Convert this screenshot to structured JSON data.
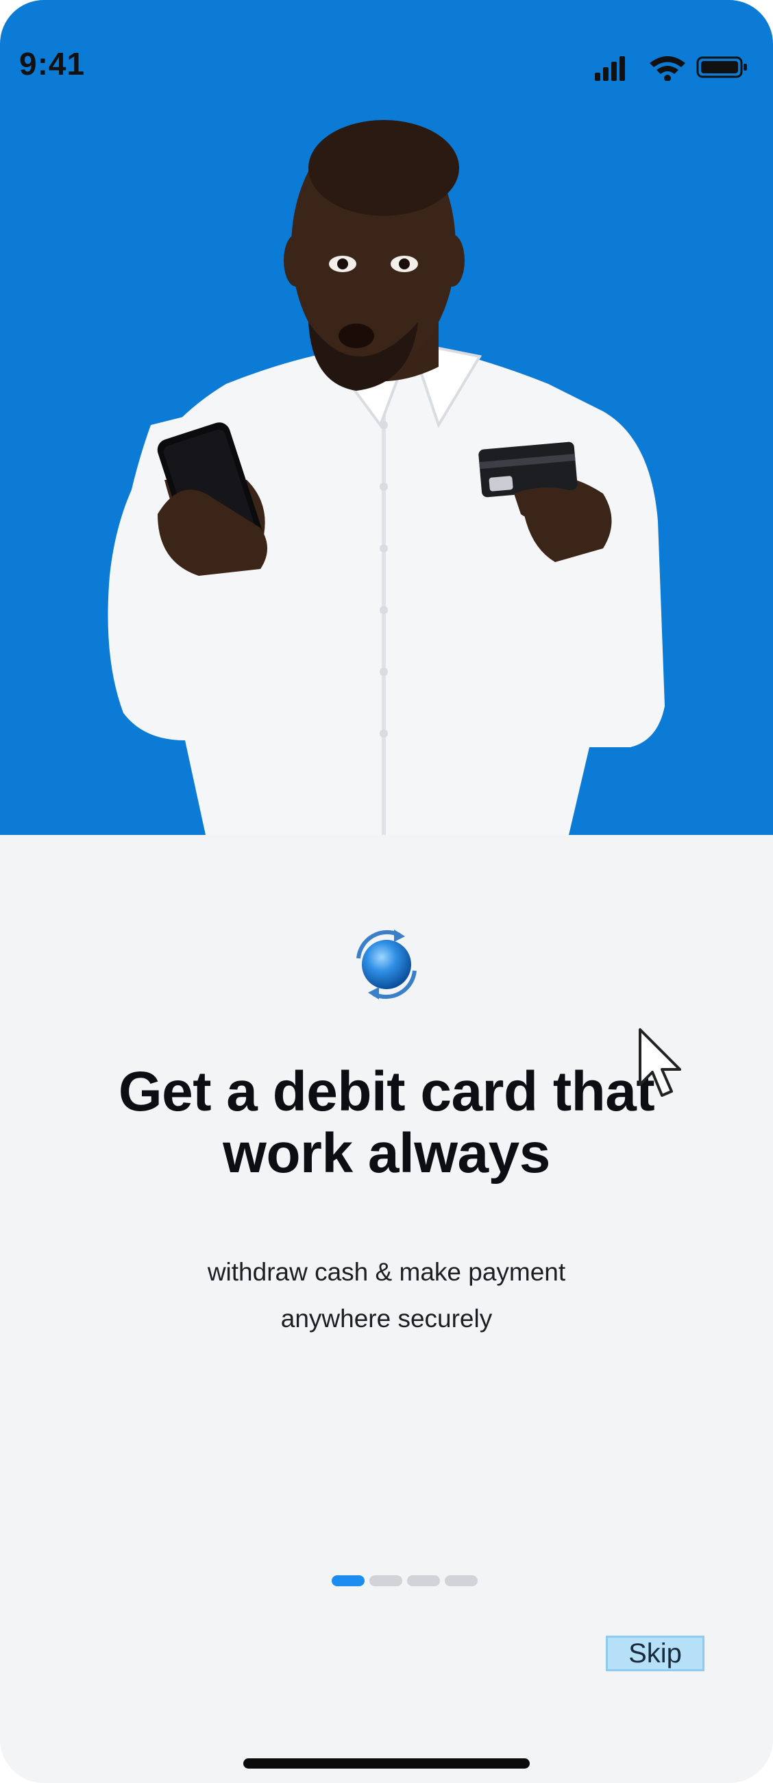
{
  "status_bar": {
    "time": "9:41",
    "icons": [
      "signal-icon",
      "wifi-icon",
      "battery-icon"
    ]
  },
  "hero": {
    "background_color": "#0b7bd6",
    "image": "man-holding-phone-and-card"
  },
  "onboarding": {
    "logo_icon": "globe-refresh-icon",
    "headline": "Get a debit card that work always",
    "subtext_line1": "withdraw cash & make payment",
    "subtext_line2": "anywhere securely",
    "page_count": 4,
    "active_page": 1,
    "skip_label": "Skip",
    "accent_color": "#1c8cf0"
  }
}
